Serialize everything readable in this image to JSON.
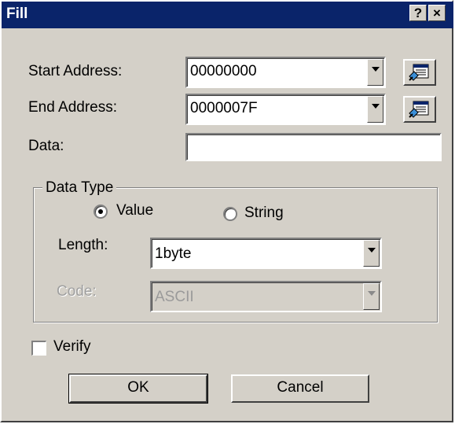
{
  "window": {
    "title": "Fill",
    "help_label": "?",
    "close_label": "×"
  },
  "fields": {
    "start_address": {
      "label": "Start Address:",
      "value": "00000000"
    },
    "end_address": {
      "label": "End Address:",
      "value": "0000007F"
    },
    "data": {
      "label": "Data:",
      "value": ""
    }
  },
  "data_type": {
    "title": "Data Type",
    "options": [
      {
        "label": "Value",
        "selected": true
      },
      {
        "label": "String",
        "selected": false
      }
    ],
    "length": {
      "label": "Length:",
      "value": "1byte"
    },
    "code": {
      "label": "Code:",
      "value": "ASCII",
      "enabled": false
    }
  },
  "verify": {
    "label": "Verify",
    "checked": false
  },
  "buttons": {
    "ok": "OK",
    "cancel": "Cancel"
  },
  "icons": {
    "browse": "address-browse-icon"
  }
}
